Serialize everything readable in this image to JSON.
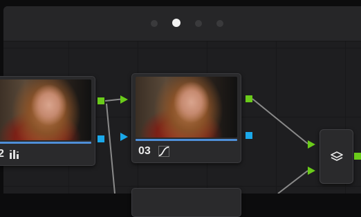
{
  "pager": {
    "pages": 4,
    "active_index": 1
  },
  "nodes": [
    {
      "id": "node-02",
      "label": "2",
      "icon": "levels-icon"
    },
    {
      "id": "node-03",
      "label": "03",
      "icon": "curve-icon"
    }
  ],
  "layer_mixer": {
    "icon": "layers-icon"
  },
  "colors": {
    "rgb_port": "#6acb1a",
    "alpha_port": "#1aa8ea",
    "wire": "#8a8a8a",
    "progress": "#4f8fd8"
  }
}
